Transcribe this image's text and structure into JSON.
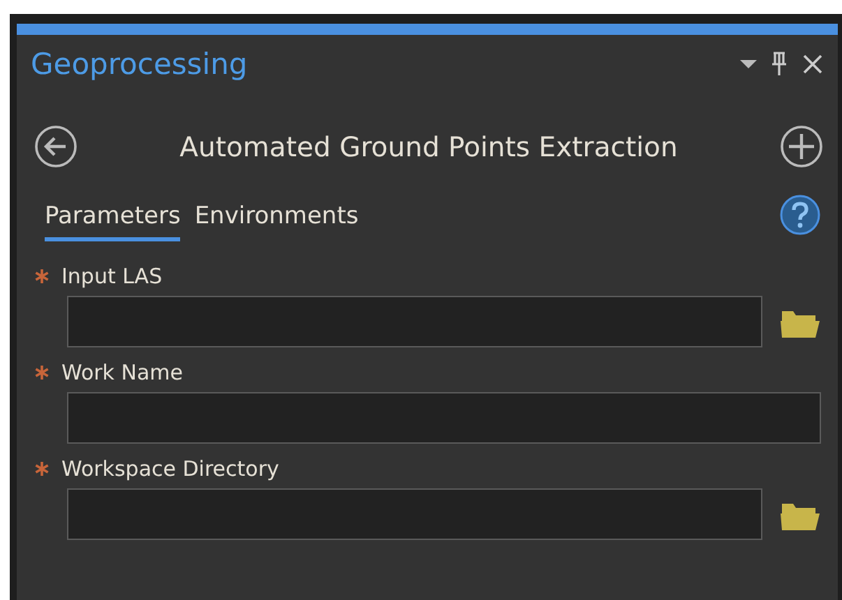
{
  "pane": {
    "title": "Geoprocessing"
  },
  "tool": {
    "title": "Automated Ground Points Extraction"
  },
  "tabs": [
    {
      "label": "Parameters",
      "selected": true
    },
    {
      "label": "Environments",
      "selected": false
    }
  ],
  "parameters": [
    {
      "label": "Input LAS",
      "required": true,
      "browse": true
    },
    {
      "label": "Work Name",
      "required": true,
      "browse": false
    },
    {
      "label": "Workspace Directory",
      "required": true,
      "browse": true
    }
  ]
}
